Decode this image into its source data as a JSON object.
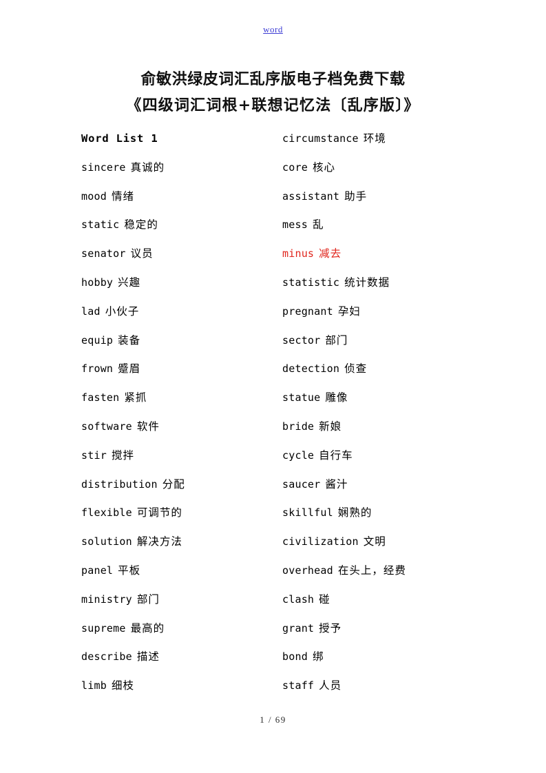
{
  "header": {
    "link_label": "word"
  },
  "title": {
    "line1": "俞敏洪绿皮词汇乱序版电子档免费下载",
    "line2": "《四级词汇词根+联想记忆法〔乱序版〕》"
  },
  "colors": {
    "link": "#3b3bd4",
    "highlight": "#e0251c",
    "text": "#000000"
  },
  "columns": {
    "left": [
      {
        "term": "Word List 1",
        "gloss": "",
        "style": "heading"
      },
      {
        "term": "sincere",
        "gloss": "真诚的",
        "style": "normal"
      },
      {
        "term": "mood",
        "gloss": "情绪",
        "style": "normal"
      },
      {
        "term": "static",
        "gloss": "稳定的",
        "style": "normal"
      },
      {
        "term": "senator",
        "gloss": "议员",
        "style": "normal"
      },
      {
        "term": "hobby",
        "gloss": "兴趣",
        "style": "normal"
      },
      {
        "term": "lad",
        "gloss": "小伙子",
        "style": "normal"
      },
      {
        "term": "equip",
        "gloss": "装备",
        "style": "normal"
      },
      {
        "term": "frown",
        "gloss": "蹙眉",
        "style": "normal"
      },
      {
        "term": "fasten",
        "gloss": "紧抓",
        "style": "normal"
      },
      {
        "term": "software",
        "gloss": "软件",
        "style": "normal"
      },
      {
        "term": "stir",
        "gloss": "搅拌",
        "style": "normal"
      },
      {
        "term": "distribution",
        "gloss": "分配",
        "style": "normal"
      },
      {
        "term": "flexible",
        "gloss": "可调节的",
        "style": "normal"
      },
      {
        "term": "solution",
        "gloss": "解决方法",
        "style": "normal"
      },
      {
        "term": "panel",
        "gloss": "平板",
        "style": "normal"
      },
      {
        "term": "ministry",
        "gloss": "部门",
        "style": "normal"
      },
      {
        "term": "supreme",
        "gloss": "最高的",
        "style": "normal"
      },
      {
        "term": "describe",
        "gloss": "描述",
        "style": "normal"
      },
      {
        "term": "limb",
        "gloss": "细枝",
        "style": "normal"
      }
    ],
    "right": [
      {
        "term": "circumstance",
        "gloss": "环境",
        "style": "normal"
      },
      {
        "term": "core",
        "gloss": "核心",
        "style": "normal"
      },
      {
        "term": "assistant",
        "gloss": "助手",
        "style": "normal"
      },
      {
        "term": "mess",
        "gloss": "乱",
        "style": "normal"
      },
      {
        "term": "minus",
        "gloss": "减去",
        "style": "highlight"
      },
      {
        "term": "statistic",
        "gloss": "统计数据",
        "style": "normal"
      },
      {
        "term": "pregnant",
        "gloss": "孕妇",
        "style": "normal"
      },
      {
        "term": "sector",
        "gloss": "部门",
        "style": "normal"
      },
      {
        "term": "detection",
        "gloss": "侦查",
        "style": "normal"
      },
      {
        "term": "statue",
        "gloss": "雕像",
        "style": "normal"
      },
      {
        "term": "bride",
        "gloss": "新娘",
        "style": "normal"
      },
      {
        "term": "cycle",
        "gloss": "自行车",
        "style": "normal"
      },
      {
        "term": "saucer",
        "gloss": "酱汁",
        "style": "normal"
      },
      {
        "term": "skillful",
        "gloss": "娴熟的",
        "style": "normal"
      },
      {
        "term": "civilization",
        "gloss": "文明",
        "style": "normal"
      },
      {
        "term": "overhead",
        "gloss": "在头上，经费",
        "style": "normal"
      },
      {
        "term": "clash",
        "gloss": "碰",
        "style": "normal"
      },
      {
        "term": "grant",
        "gloss": "授予",
        "style": "normal"
      },
      {
        "term": "bond",
        "gloss": "绑",
        "style": "normal"
      },
      {
        "term": "staff",
        "gloss": "人员",
        "style": "normal"
      }
    ]
  },
  "footer": {
    "page_indicator": "1 / 69"
  }
}
